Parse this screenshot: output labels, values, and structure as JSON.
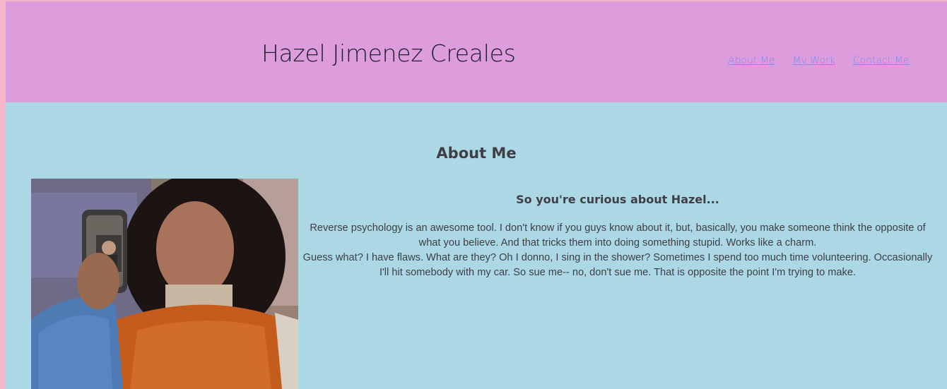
{
  "header": {
    "title": "Hazel Jimenez Creales",
    "nav": [
      {
        "label": "About Me"
      },
      {
        "label": "My Work"
      },
      {
        "label": "Contact Me"
      }
    ]
  },
  "about": {
    "heading": "About Me",
    "subheading": "So you're curious about Hazel...",
    "paragraph_1": "Reverse psychology is an awesome tool. I don't know if you guys know about it, but, basically, you make someone think the opposite of what you believe. And that tricks them into doing something stupid. Works like a charm.",
    "paragraph_2": "Guess what? I have flaws. What are they? Oh I donno, I sing in the shower? Sometimes I spend too much time volunteering. Occasionally I'll hit somebody with my car. So sue me-- no, don't sue me. That is opposite the point I'm trying to make.",
    "photo": {
      "icon": "profile-photo"
    }
  },
  "colors": {
    "page_bg": "#f4b6c8",
    "header_bg": "#dd9ddc",
    "main_bg": "#acd8e5",
    "link": "#7b8cf0",
    "text": "#3e3e44"
  }
}
